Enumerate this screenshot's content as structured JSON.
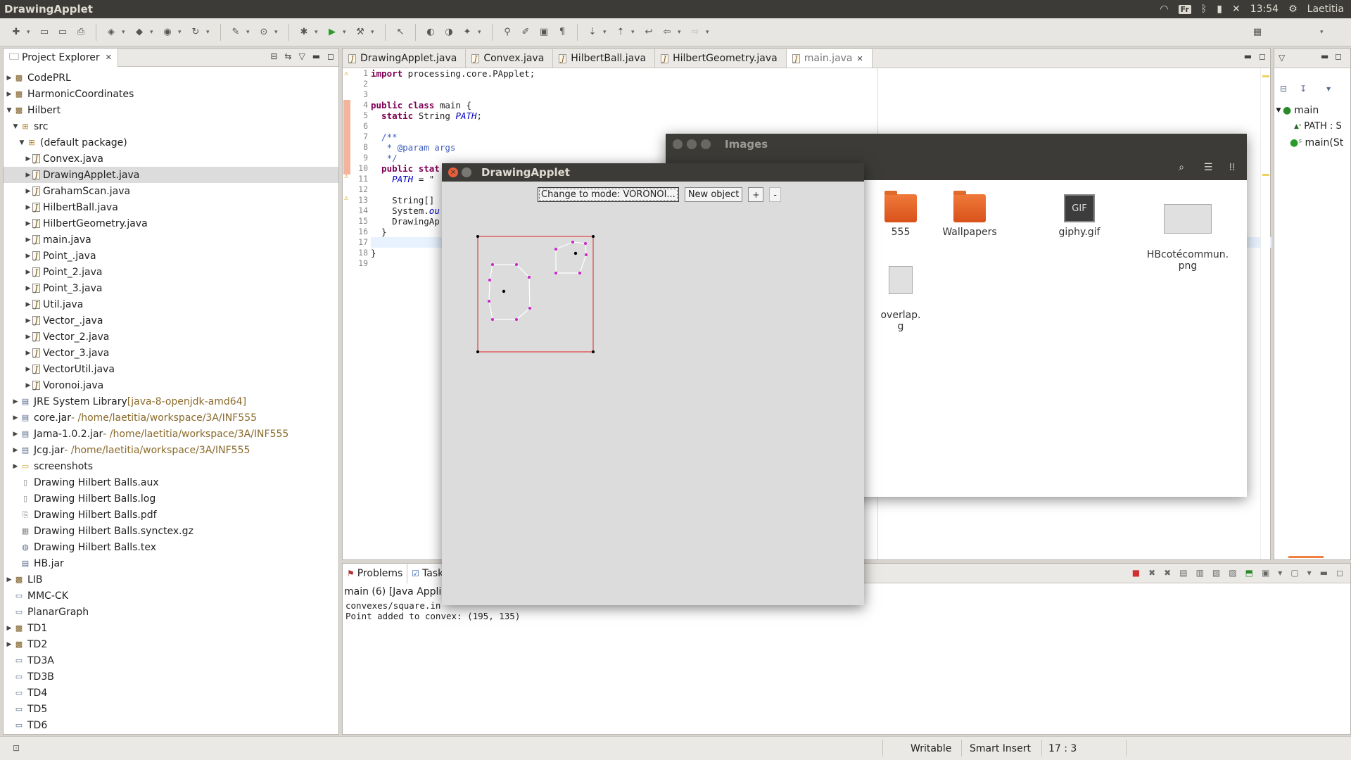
{
  "window_title": "DrawingApplet",
  "tray": {
    "kbd": "Fr",
    "time": "13:54",
    "user": "Laetitia"
  },
  "explorer": {
    "title": "Project Explorer",
    "items": [
      {
        "label": "CodePRL",
        "depth": 0,
        "twisty": "▶",
        "icon": "proj"
      },
      {
        "label": "HarmonicCoordinates",
        "depth": 0,
        "twisty": "▶",
        "icon": "proj"
      },
      {
        "label": "Hilbert",
        "depth": 0,
        "twisty": "▼",
        "icon": "proj"
      },
      {
        "label": "src",
        "depth": 1,
        "twisty": "▼",
        "icon": "pkg"
      },
      {
        "label": "(default package)",
        "depth": 2,
        "twisty": "▼",
        "icon": "pkg"
      },
      {
        "label": "Convex.java",
        "depth": 3,
        "twisty": "▶",
        "icon": "java"
      },
      {
        "label": "DrawingApplet.java",
        "depth": 3,
        "twisty": "▶",
        "icon": "java",
        "selected": true
      },
      {
        "label": "GrahamScan.java",
        "depth": 3,
        "twisty": "▶",
        "icon": "java"
      },
      {
        "label": "HilbertBall.java",
        "depth": 3,
        "twisty": "▶",
        "icon": "java"
      },
      {
        "label": "HilbertGeometry.java",
        "depth": 3,
        "twisty": "▶",
        "icon": "java"
      },
      {
        "label": "main.java",
        "depth": 3,
        "twisty": "▶",
        "icon": "java"
      },
      {
        "label": "Point_.java",
        "depth": 3,
        "twisty": "▶",
        "icon": "java"
      },
      {
        "label": "Point_2.java",
        "depth": 3,
        "twisty": "▶",
        "icon": "java"
      },
      {
        "label": "Point_3.java",
        "depth": 3,
        "twisty": "▶",
        "icon": "java"
      },
      {
        "label": "Util.java",
        "depth": 3,
        "twisty": "▶",
        "icon": "java"
      },
      {
        "label": "Vector_.java",
        "depth": 3,
        "twisty": "▶",
        "icon": "java"
      },
      {
        "label": "Vector_2.java",
        "depth": 3,
        "twisty": "▶",
        "icon": "java"
      },
      {
        "label": "Vector_3.java",
        "depth": 3,
        "twisty": "▶",
        "icon": "java"
      },
      {
        "label": "VectorUtil.java",
        "depth": 3,
        "twisty": "▶",
        "icon": "java"
      },
      {
        "label": "Voronoi.java",
        "depth": 3,
        "twisty": "▶",
        "icon": "java"
      },
      {
        "label": "JRE System Library",
        "suffix": " [java-8-openjdk-amd64]",
        "depth": 1,
        "twisty": "▶",
        "icon": "jar"
      },
      {
        "label": "core.jar",
        "suffix": " - /home/laetitia/workspace/3A/INF555",
        "depth": 1,
        "twisty": "▶",
        "icon": "jar"
      },
      {
        "label": "Jama-1.0.2.jar",
        "suffix": " - /home/laetitia/workspace/3A/INF555",
        "depth": 1,
        "twisty": "▶",
        "icon": "jar"
      },
      {
        "label": "Jcg.jar",
        "suffix": " - /home/laetitia/workspace/3A/INF555",
        "depth": 1,
        "twisty": "▶",
        "icon": "jar"
      },
      {
        "label": "screenshots",
        "depth": 1,
        "twisty": "▶",
        "icon": "folder"
      },
      {
        "label": "Drawing Hilbert Balls.aux",
        "depth": 1,
        "twisty": "",
        "icon": "plain"
      },
      {
        "label": "Drawing Hilbert Balls.log",
        "depth": 1,
        "twisty": "",
        "icon": "plain"
      },
      {
        "label": "Drawing Hilbert Balls.pdf",
        "depth": 1,
        "twisty": "",
        "icon": "pdf"
      },
      {
        "label": "Drawing Hilbert Balls.synctex.gz",
        "depth": 1,
        "twisty": "",
        "icon": "gz"
      },
      {
        "label": "Drawing Hilbert Balls.tex",
        "depth": 1,
        "twisty": "",
        "icon": "tex"
      },
      {
        "label": "HB.jar",
        "depth": 1,
        "twisty": "",
        "icon": "jar"
      },
      {
        "label": "LIB",
        "depth": 0,
        "twisty": "▶",
        "icon": "proj"
      },
      {
        "label": "MMC-CK",
        "depth": 0,
        "twisty": "",
        "icon": "closed"
      },
      {
        "label": "PlanarGraph",
        "depth": 0,
        "twisty": "",
        "icon": "closed"
      },
      {
        "label": "TD1",
        "depth": 0,
        "twisty": "▶",
        "icon": "proj"
      },
      {
        "label": "TD2",
        "depth": 0,
        "twisty": "▶",
        "icon": "proj"
      },
      {
        "label": "TD3A",
        "depth": 0,
        "twisty": "",
        "icon": "closed"
      },
      {
        "label": "TD3B",
        "depth": 0,
        "twisty": "",
        "icon": "closed"
      },
      {
        "label": "TD4",
        "depth": 0,
        "twisty": "",
        "icon": "closed"
      },
      {
        "label": "TD5",
        "depth": 0,
        "twisty": "",
        "icon": "closed"
      },
      {
        "label": "TD6",
        "depth": 0,
        "twisty": "",
        "icon": "closed"
      }
    ]
  },
  "editor": {
    "tabs": [
      "DrawingApplet.java",
      "Convex.java",
      "HilbertBall.java",
      "HilbertGeometry.java",
      "main.java"
    ],
    "active_tab": 4,
    "line_numbers": [
      "1",
      "2",
      "3",
      "4",
      "5",
      "6",
      "7",
      "8",
      "9",
      "10",
      "11",
      "12",
      "13",
      "14",
      "15",
      "16",
      "17",
      "18",
      "19"
    ],
    "code": {
      "l1_kw": "import",
      "l1_rest": " processing.core.PApplet;",
      "l4_kw": "public class",
      "l4_rest": " main {",
      "l5_kw": "  static",
      "l5_rest": " String ",
      "l5_field": "PATH",
      "l5_end": ";",
      "l7": "  /**",
      "l8": "   * @param args",
      "l9": "   */",
      "l10_kw": "  public stat",
      "l11_a": "    ",
      "l11_field": "PATH",
      "l11_b": " = \"",
      "l13": "    String[]",
      "l14": "    System.",
      "l14_field": "ou",
      "l15": "    DrawingAp",
      "l16": "  }",
      "l18": "}"
    }
  },
  "outline": {
    "root": "main",
    "items": [
      "PATH : S",
      "main(St"
    ]
  },
  "console": {
    "tabs": [
      "Problems",
      "Task"
    ],
    "desc": "main (6) [Java Applic",
    "lines": [
      "convexes/square.in",
      "Point added to convex: (195, 135)"
    ]
  },
  "statusbar": {
    "writable": "Writable",
    "insert": "Smart Insert",
    "position": "17 : 3"
  },
  "images_window": {
    "title": "Images",
    "items": [
      {
        "label": "555",
        "type": "folder"
      },
      {
        "label": "Wallpapers",
        "type": "folder"
      },
      {
        "label": "giphy.gif",
        "type": "gif",
        "badge": "GIF"
      },
      {
        "label": "HBcotécommun.\npng",
        "type": "png"
      },
      {
        "label": "overlap.\ng",
        "type": "png"
      }
    ]
  },
  "applet": {
    "title": "DrawingApplet",
    "mode_button": "Change to mode: VORONOI...",
    "new_object_button": "New object",
    "plus_button": "+",
    "minus_button": "-"
  }
}
